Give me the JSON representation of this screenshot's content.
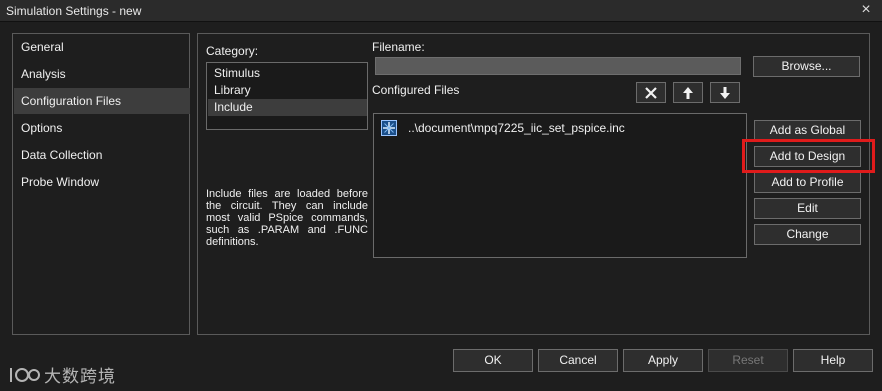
{
  "window": {
    "title": "Simulation Settings - new",
    "close_glyph": "×"
  },
  "nav": {
    "items": [
      {
        "label": "General",
        "selected": false
      },
      {
        "label": "Analysis",
        "selected": false
      },
      {
        "label": "Configuration Files",
        "selected": true
      },
      {
        "label": "Options",
        "selected": false
      },
      {
        "label": "Data Collection",
        "selected": false
      },
      {
        "label": "Probe Window",
        "selected": false
      }
    ]
  },
  "category": {
    "label": "Category:",
    "items": [
      {
        "label": "Stimulus",
        "selected": false
      },
      {
        "label": "Library",
        "selected": false
      },
      {
        "label": "Include",
        "selected": true
      }
    ],
    "description": "Include files are loaded before the circuit. They can include most valid PSpice commands, such as .PARAM and .FUNC definitions."
  },
  "filename": {
    "label": "Filename:",
    "value": "",
    "browse_label": "Browse..."
  },
  "configured_files": {
    "label": "Configured Files",
    "files": [
      {
        "path": "..\\document\\mpq7225_iic_set_pspice.inc",
        "icon": "include-file-icon"
      }
    ]
  },
  "toolbar": {
    "delete_icon": "delete-icon",
    "move_up_icon": "arrow-up-icon",
    "move_down_icon": "arrow-down-icon"
  },
  "actions": {
    "add_global": "Add as Global",
    "add_design": "Add to Design",
    "add_profile": "Add to Profile",
    "edit": "Edit",
    "change": "Change"
  },
  "footer": {
    "ok": "OK",
    "cancel": "Cancel",
    "apply": "Apply",
    "reset": "Reset",
    "help": "Help"
  },
  "watermark": {
    "text": "大数跨境"
  },
  "colors": {
    "background": "#1e1e1e",
    "highlight": "#e01b1b",
    "selection": "#3d3d3d"
  }
}
